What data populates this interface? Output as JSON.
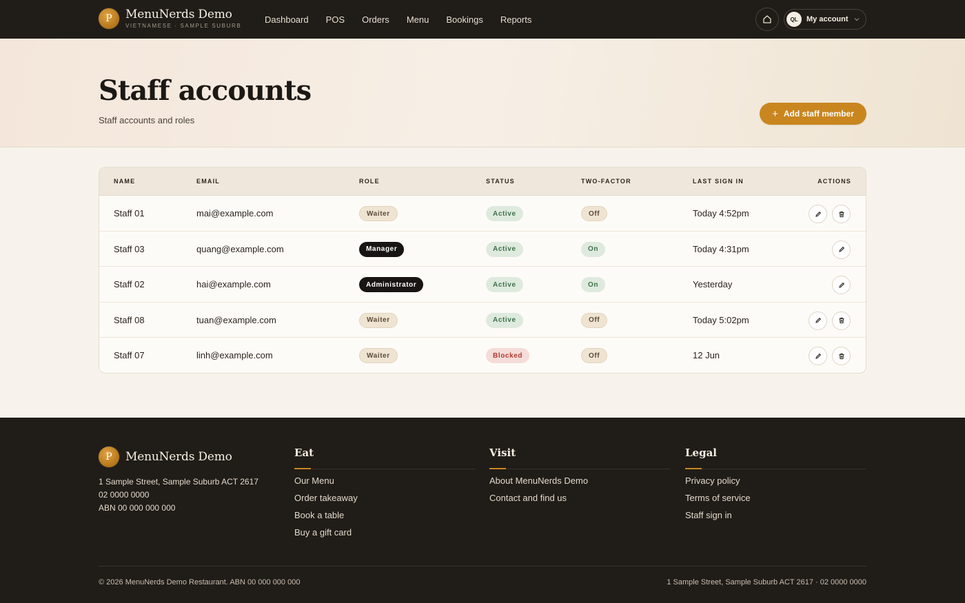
{
  "nav": {
    "brand_name": "MenuNerds Demo",
    "brand_sub": "VIETNAMESE · SAMPLE SUBURB",
    "logo_letter": "P",
    "items": [
      "Dashboard",
      "POS",
      "Orders",
      "Menu",
      "Bookings",
      "Reports"
    ],
    "account_initials": "QL",
    "account_label": "My account",
    "home_icon": "home-icon"
  },
  "hero": {
    "title": "Staff accounts",
    "subtitle": "Staff accounts and roles",
    "add_button": "Add staff member"
  },
  "table": {
    "headers": {
      "name": "NAME",
      "email": "EMAIL",
      "role": "ROLE",
      "status": "STATUS",
      "two_factor": "TWO-FACTOR",
      "last_sign_in": "LAST SIGN IN",
      "actions": "ACTIONS"
    },
    "rows": [
      {
        "name": "Staff 01",
        "email": "mai@example.com",
        "role": "Waiter",
        "status": "Active",
        "two_factor": "Off",
        "last_sign_in": "Today 4:52pm",
        "actions": [
          "edit",
          "delete"
        ]
      },
      {
        "name": "Staff 03",
        "email": "quang@example.com",
        "role": "Manager",
        "status": "Active",
        "two_factor": "On",
        "last_sign_in": "Today 4:31pm",
        "actions": [
          "edit"
        ]
      },
      {
        "name": "Staff 02",
        "email": "hai@example.com",
        "role": "Administrator",
        "status": "Active",
        "two_factor": "On",
        "last_sign_in": "Yesterday",
        "actions": [
          "edit"
        ]
      },
      {
        "name": "Staff 08",
        "email": "tuan@example.com",
        "role": "Waiter",
        "status": "Active",
        "two_factor": "Off",
        "last_sign_in": "Today 5:02pm",
        "actions": [
          "edit",
          "delete"
        ]
      },
      {
        "name": "Staff 07",
        "email": "linh@example.com",
        "role": "Waiter",
        "status": "Blocked",
        "two_factor": "Off",
        "last_sign_in": "12 Jun",
        "actions": [
          "edit",
          "delete"
        ]
      }
    ]
  },
  "footer": {
    "brand_name": "MenuNerds Demo",
    "logo_letter": "P",
    "address_lines": [
      "1 Sample Street, Sample Suburb ACT 2617",
      "02 0000 0000",
      "ABN 00 000 000 000"
    ],
    "columns": [
      {
        "title": "Eat",
        "links": [
          "Our Menu",
          "Order takeaway",
          "Book a table",
          "Buy a gift card"
        ]
      },
      {
        "title": "Visit",
        "links": [
          "About MenuNerds Demo",
          "Contact and find us"
        ]
      },
      {
        "title": "Legal",
        "links": [
          "Privacy policy",
          "Terms of service",
          "Staff sign in"
        ]
      }
    ],
    "copyright": "© 2026 MenuNerds Demo Restaurant. ABN 00 000 000 000",
    "contact_line": "1 Sample Street, Sample Suburb ACT 2617 · 02 0000 0000"
  },
  "colors": {
    "accent": "#c9861f",
    "dark": "#201c18",
    "active": "#3e7049",
    "blocked": "#b03a32"
  }
}
